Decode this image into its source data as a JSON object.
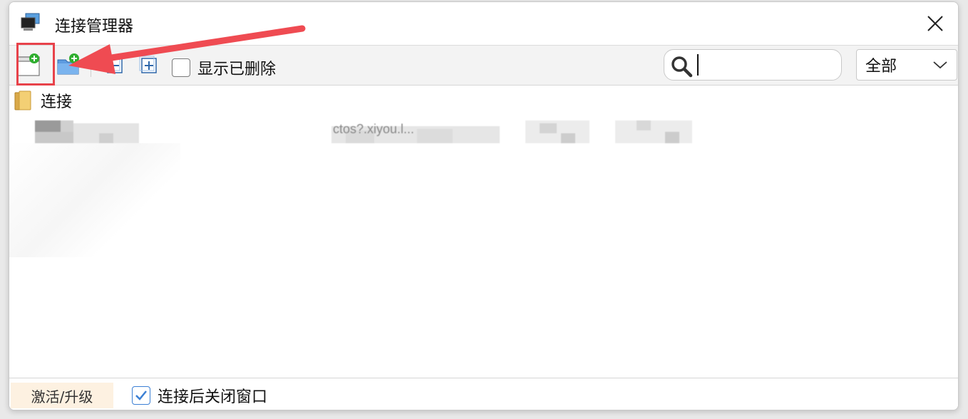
{
  "window": {
    "title": "连接管理器"
  },
  "toolbar": {
    "new_session_icon": "new-session-icon",
    "new_folder_icon": "new-folder-icon",
    "collapse_icon": "collapse-all-icon",
    "expand_icon": "expand-all-icon",
    "show_deleted_label": "显示已删除",
    "show_deleted_checked": false,
    "search_value": "",
    "filter_selected": "全部"
  },
  "tree": {
    "folder_label": "连接",
    "connections": [
      {
        "name": "",
        "host": "ctos?.xiyou.l...",
        "port": "",
        "user": ""
      }
    ]
  },
  "statusbar": {
    "upgrade_label": "激活/升级",
    "close_after_connect_label": "连接后关闭窗口",
    "close_after_connect_checked": true
  },
  "colors": {
    "annotation_red": "#e8424a",
    "accent_blue": "#3b7fd4",
    "upgrade_bg": "#fdf1e1"
  }
}
